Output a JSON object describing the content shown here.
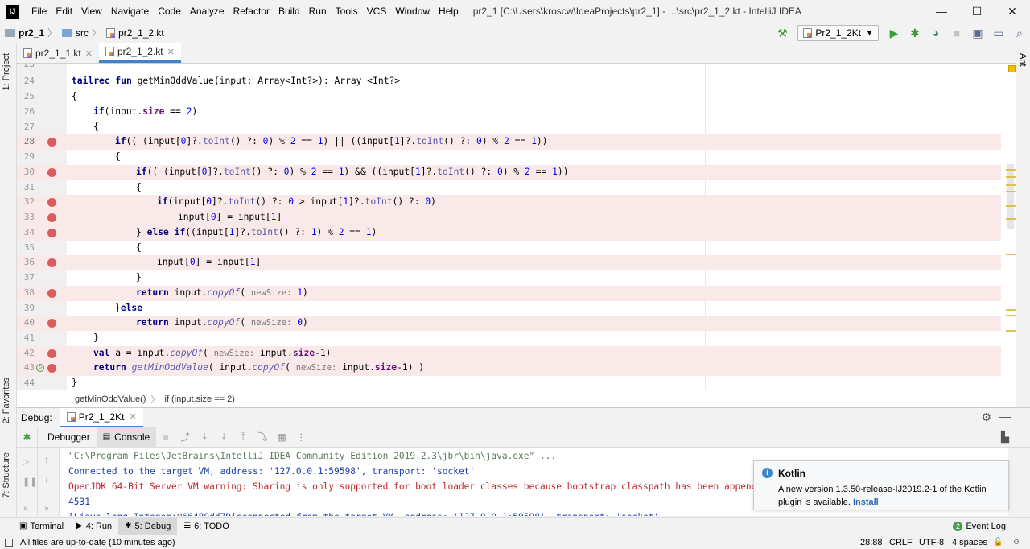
{
  "app": {
    "logo_text": "IJ",
    "window_title": "pr2_1 [C:\\Users\\kroscw\\IdeaProjects\\pr2_1] - ...\\src\\pr2_1_2.kt - IntelliJ IDEA"
  },
  "menu": [
    "File",
    "Edit",
    "View",
    "Navigate",
    "Code",
    "Analyze",
    "Refactor",
    "Build",
    "Run",
    "Tools",
    "VCS",
    "Window",
    "Help"
  ],
  "window_controls": {
    "minimize": "—",
    "maximize": "☐",
    "close": "✕"
  },
  "breadcrumbs": [
    "pr2_1",
    "src",
    "pr2_1_2.kt"
  ],
  "run_config": "Pr2_1_2Kt",
  "left_tool_tabs": {
    "project": "1: Project",
    "favorites": "2: Favorites",
    "structure": "7: Structure"
  },
  "right_tool_tabs": {
    "ant": "Ant"
  },
  "editor_tabs": [
    {
      "label": "pr2_1_1.kt",
      "active": false
    },
    {
      "label": "pr2_1_2.kt",
      "active": true
    }
  ],
  "editor": {
    "lines": [
      {
        "num": "23",
        "bp": false
      },
      {
        "num": "24",
        "bp": false
      },
      {
        "num": "25",
        "bp": false
      },
      {
        "num": "26",
        "bp": false
      },
      {
        "num": "27",
        "bp": false
      },
      {
        "num": "28",
        "bp": true
      },
      {
        "num": "29",
        "bp": false
      },
      {
        "num": "30",
        "bp": true
      },
      {
        "num": "31",
        "bp": false
      },
      {
        "num": "32",
        "bp": true
      },
      {
        "num": "33",
        "bp": true
      },
      {
        "num": "34",
        "bp": true
      },
      {
        "num": "35",
        "bp": false
      },
      {
        "num": "36",
        "bp": true
      },
      {
        "num": "37",
        "bp": false
      },
      {
        "num": "38",
        "bp": true
      },
      {
        "num": "39",
        "bp": false
      },
      {
        "num": "40",
        "bp": true
      },
      {
        "num": "41",
        "bp": false
      },
      {
        "num": "42",
        "bp": true
      },
      {
        "num": "43",
        "bp": true
      },
      {
        "num": "44",
        "bp": false
      }
    ],
    "code": {
      "l23": "",
      "l24_kw1": "tailrec",
      "l24_kw2": "fun",
      "l24_rest": " getMinOddValue(input: Array<Int?>): Array <Int?>",
      "l25": "{",
      "l26_kw": "if",
      "l26_a": "(input.",
      "l26_fld": "size",
      "l26_b": " == ",
      "l26_num": "2",
      "l26_c": ")",
      "l27": "{",
      "l28_kw": "if",
      "l28_a": "(( (input[",
      "l28_n0": "0",
      "l28_b": "]?.",
      "l28_m1": "toInt",
      "l28_c": "() ?: ",
      "l28_n1": "0",
      "l28_d": ") % ",
      "l28_n2": "2",
      "l28_e": " == ",
      "l28_n3": "1",
      "l28_f": ") || ((input[",
      "l28_n4": "1",
      "l28_g": "]?.",
      "l28_m2": "toInt",
      "l28_h": "() ?: ",
      "l28_n5": "0",
      "l28_i": ") % ",
      "l28_n6": "2",
      "l28_j": " == ",
      "l28_n7": "1",
      "l28_k": "))",
      "l29": "{",
      "l30_kw": "if",
      "l30_a": "(( (input[",
      "l30_n0": "0",
      "l30_b": "]?.",
      "l30_m1": "toInt",
      "l30_c": "() ?: ",
      "l30_n1": "0",
      "l30_d": ") % ",
      "l30_n2": "2",
      "l30_e": " == ",
      "l30_n3": "1",
      "l30_f": ") && ((input[",
      "l30_n4": "1",
      "l30_g": "]?.",
      "l30_m2": "toInt",
      "l30_h": "() ?: ",
      "l30_n5": "0",
      "l30_i": ") % ",
      "l30_n6": "2",
      "l30_j": " == ",
      "l30_n7": "1",
      "l30_k": "))",
      "l31": "{",
      "l32_kw": "if",
      "l32_a": "(input[",
      "l32_n0": "0",
      "l32_b": "]?.",
      "l32_m1": "toInt",
      "l32_c": "() ?: ",
      "l32_n1": "0",
      "l32_d": " > input[",
      "l32_n2": "1",
      "l32_e": "]?.",
      "l32_m2": "toInt",
      "l32_f": "() ?: ",
      "l32_n3": "0",
      "l32_g": ")",
      "l33_a": "input[",
      "l33_n0": "0",
      "l33_b": "] = input[",
      "l33_n1": "1",
      "l33_c": "]",
      "l34_a": "} ",
      "l34_kw1": "else",
      "l34_sp": " ",
      "l34_kw2": "if",
      "l34_b": "((input[",
      "l34_n0": "1",
      "l34_c": "]?.",
      "l34_m1": "toInt",
      "l34_d": "() ?: ",
      "l34_n1": "1",
      "l34_e": ") % ",
      "l34_n2": "2",
      "l34_f": " == ",
      "l34_n3": "1",
      "l34_g": ")",
      "l35": "{",
      "l36_a": "input[",
      "l36_n0": "0",
      "l36_b": "] = input[",
      "l36_n1": "1",
      "l36_c": "]",
      "l37": "}",
      "l38_kw": "return",
      "l38_a": " input.",
      "l38_m": "copyOf",
      "l38_b": "( ",
      "l38_hint": "newSize:",
      "l38_sp": " ",
      "l38_n": "1",
      "l38_c": ")",
      "l39_a": "}",
      "l39_kw": "else",
      "l40_kw": "return",
      "l40_a": " input.",
      "l40_m": "copyOf",
      "l40_b": "( ",
      "l40_hint": "newSize:",
      "l40_sp": " ",
      "l40_n": "0",
      "l40_c": ")",
      "l41": "}",
      "l42_kw": "val",
      "l42_a": " a = input.",
      "l42_m": "copyOf",
      "l42_b": "( ",
      "l42_hint": "newSize:",
      "l42_c": " input.",
      "l42_fld": "size",
      "l42_d": "-1)",
      "l43_kw": "return",
      "l43_sp": " ",
      "l43_m1": "getMinOddValue",
      "l43_a": "( input.",
      "l43_m2": "copyOf",
      "l43_b": "( ",
      "l43_hint": "newSize:",
      "l43_c": " input.",
      "l43_fld": "size",
      "l43_d": "-1) )",
      "l44": "}"
    },
    "colors": {
      "keyword": "#000080",
      "number": "#0000ff",
      "field": "#660e7a",
      "breakpoint": "#db5c5c",
      "breakpoint_line": "#fae9e9"
    }
  },
  "editor_breadcrumb": [
    "getMinOddValue()",
    "if (input.size == 2)"
  ],
  "debug": {
    "title": "Debug:",
    "session": "Pr2_1_2Kt",
    "tabs": [
      "Debugger",
      "Console"
    ]
  },
  "console": {
    "lines": [
      {
        "text": "\"C:\\Program Files\\JetBrains\\IntelliJ IDEA Community Edition 2019.2.3\\jbr\\bin\\java.exe\" ...",
        "color": "#5a7a5a"
      },
      {
        "text": "Connected to the target VM, address: '127.0.0.1:59598', transport: 'socket'",
        "color": "#1a3fae"
      },
      {
        "text": "OpenJDK 64-Bit Server VM warning: Sharing is only supported for boot loader classes because bootstrap classpath has been appended",
        "color": "#c02222"
      },
      {
        "text": "4531",
        "color": "#1a3fae"
      },
      {
        "text": "[Ljava.lang.Integer;@66480dd7Disconnected from the target VM, address: '127.0.0.1:59598', transport: 'socket'",
        "color": "#1a3fae"
      }
    ]
  },
  "notification": {
    "title": "Kotlin",
    "body": "A new version 1.3.50-release-IJ2019.2-1 of the Kotlin plugin is available.",
    "link": "Install"
  },
  "bottom_tools": [
    {
      "label": "Terminal",
      "active": false
    },
    {
      "label": "4: Run",
      "active": false
    },
    {
      "label": "5: Debug",
      "active": true
    },
    {
      "label": "6: TODO",
      "active": false
    }
  ],
  "event_log": "Event Log",
  "status": {
    "message": "All files are up-to-date (10 minutes ago)",
    "position": "28:88",
    "line_sep": "CRLF",
    "encoding": "UTF-8",
    "indent": "4 spaces"
  }
}
